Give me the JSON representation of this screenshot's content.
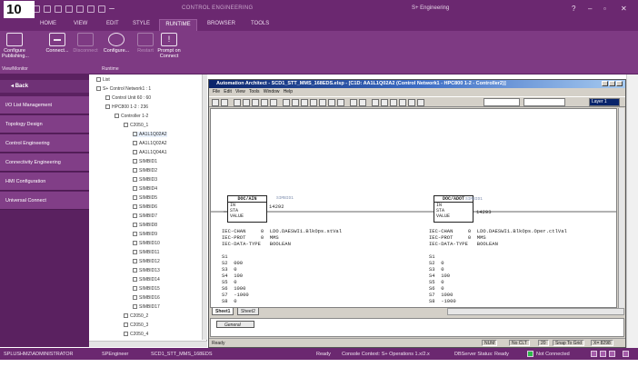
{
  "figure_number": "10",
  "app": {
    "title": "CONTROL ENGINEERING",
    "profile": "S+ Engineering",
    "controls": {
      "help": "?",
      "minimize": "–",
      "restore": "▫",
      "close": "✕"
    }
  },
  "ribbon": {
    "tabs": [
      "HOME",
      "VIEW",
      "EDIT",
      "STYLE",
      "RUNTIME",
      "BROWSER",
      "TOOLS"
    ],
    "active_tab": "RUNTIME",
    "buttons": [
      {
        "label": "Configure Publishing...",
        "enabled": true
      },
      {
        "label": "Connect...",
        "enabled": true
      },
      {
        "label": "Disconnect",
        "enabled": false
      },
      {
        "label": "Configure...",
        "enabled": true
      },
      {
        "label": "Restart",
        "enabled": false
      },
      {
        "label": "Prompt on Connect",
        "enabled": true
      }
    ],
    "groups": [
      "View/Monitor",
      "Runtime"
    ]
  },
  "sidebar": {
    "back": "Back",
    "items": [
      "I/O List Management",
      "Topology Design",
      "Control Engineering",
      "Connectivity Engineering",
      "HMI Configuration",
      "Universal Connect"
    ]
  },
  "tree": {
    "nodes": [
      "List",
      "S+ Control Network1 : 1",
      "Control Unit 60 : 60",
      "HPC800 1-2 : 236",
      "Controller 1-2",
      "C2050_1",
      "AA1L1Q02A2",
      "AA1L1Q02A2",
      "AA1L1Q04A1",
      "SIMBID1",
      "SIMBID2",
      "SIMBID3",
      "SIMBID4",
      "SIMBID5",
      "SIMBID6",
      "SIMBID7",
      "SIMBID8",
      "SIMBID9",
      "SIMBID10",
      "SIMBID11",
      "SIMBID12",
      "SIMBID13",
      "SIMBID14",
      "SIMBID15",
      "SIMBID16",
      "SIMBID17",
      "C2050_2",
      "C2050_3",
      "C2050_4"
    ]
  },
  "aa_window": {
    "title": "Automation Architect - SCD1_STT_MMS_168EDS.elsp - [C1D: AA1L1Q02A2 (Control Network1 - HPC800 1-2 - Controller2)]",
    "menu": [
      "File",
      "Edit",
      "View",
      "Tools",
      "Window",
      "Help"
    ],
    "layer": "Layer 1",
    "blocks": [
      {
        "name": "DOC/AIN",
        "ports": [
          "IN",
          "STA",
          "VALUE"
        ],
        "number": "14292",
        "caption": "SIMBID1"
      },
      {
        "name": "DOC/ADOT",
        "ports": [
          "IN",
          "STA",
          "VALUE"
        ],
        "number": "14293",
        "caption": "SIMBID1"
      }
    ],
    "left_text": "IEC-CHAN     0  LDO.DAESWI1.BlkOps.stVal\nIEC-PROT     0  MMS\nIEC-DATA-TYPE   BOOLEAN\n\nS1\nS2  000\nS3  0\nS4  100\nS5  0\nS6  1000\nS7  -1000\nS8  0",
    "right_text": "IEC-CHAN     0  LDO.DAESWI1.BlkOps.Oper.ctlVal\nIEC-PROT     0  MMS\nIEC-DATA-TYPE   BOOLEAN\n\nS1\nS2  0\nS3  0\nS4  100\nS5  0\nS6  0\nS7  1000\nS8  -1000",
    "sheet_tabs": [
      "Sheet1",
      "Sheet2"
    ],
    "messages_tab": "General",
    "status": {
      "left": "Ready",
      "num": "NUM",
      "no_clt": "No CLT",
      "zoom": "20",
      "snap": "Snap To Grid",
      "coords": "X= 8298"
    }
  },
  "bottom_status": {
    "user": "SPLUSHMZ\\ADMINISTRATOR",
    "role": "SPEngineer",
    "project": "SCD1_STT_MMS_168EDS",
    "ready": "Ready",
    "context": "Console Context: S+ Operations 1.x/2.x",
    "dbserver": "DBServer Status: Ready",
    "connection": "Not Connected"
  },
  "colors": {
    "chrome": "#6b2870",
    "ribbon": "#7e3a83",
    "sidebar": "#5a2160",
    "sidebar_item": "#813e87"
  }
}
